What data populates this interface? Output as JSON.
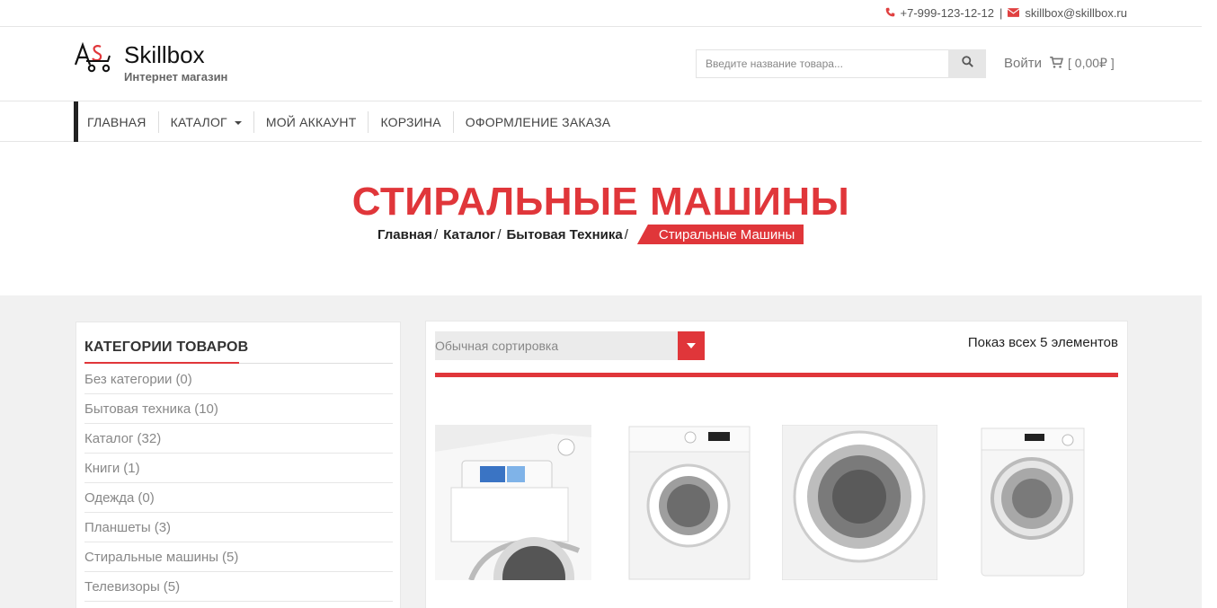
{
  "topbar": {
    "phone": "+7-999-123-12-12",
    "separator": "|",
    "email": "skillbox@skillbox.ru"
  },
  "header": {
    "logo_title": "Skillbox",
    "logo_subtitle": "Интернет магазин",
    "search_placeholder": "Введите название товара...",
    "login_label": "Войти",
    "cart_label": "[ 0,00₽ ]"
  },
  "nav": {
    "items": [
      {
        "label": "ГЛАВНАЯ"
      },
      {
        "label": "КАТАЛОГ"
      },
      {
        "label": "МОЙ АККАУНТ"
      },
      {
        "label": "КОРЗИНА"
      },
      {
        "label": "ОФОРМЛЕНИЕ ЗАКАЗА"
      }
    ]
  },
  "hero": {
    "title": "СТИРАЛЬНЫЕ МАШИНЫ",
    "breadcrumbs": [
      "Главная",
      "Каталог",
      "Бытовая Техника"
    ],
    "breadcrumb_sep": "/",
    "breadcrumb_active": "Стиральные Машины"
  },
  "sidebar": {
    "title": "КАТЕГОРИИ ТОВАРОВ",
    "categories": [
      {
        "name": "Без категории",
        "count": "(0)"
      },
      {
        "name": "Бытовая техника",
        "count": "(10)"
      },
      {
        "name": "Каталог",
        "count": "(32)"
      },
      {
        "name": "Книги",
        "count": "(1)"
      },
      {
        "name": "Одежда",
        "count": "(0)"
      },
      {
        "name": "Планшеты",
        "count": "(3)"
      },
      {
        "name": "Стиральные машины",
        "count": "(5)"
      },
      {
        "name": "Телевизоры",
        "count": "(5)"
      }
    ]
  },
  "catalog": {
    "sort_selected": "Обычная сортировка",
    "result_count": "Показ всех 5 элементов"
  },
  "colors": {
    "accent": "#e0363a",
    "nav_bar": "#222222",
    "content_bg": "#f1f1f1"
  },
  "icons": {
    "phone": "phone-icon",
    "email": "envelope-icon",
    "search": "search-icon",
    "cart": "shopping-cart-icon",
    "dropdown": "caret-down-icon"
  }
}
